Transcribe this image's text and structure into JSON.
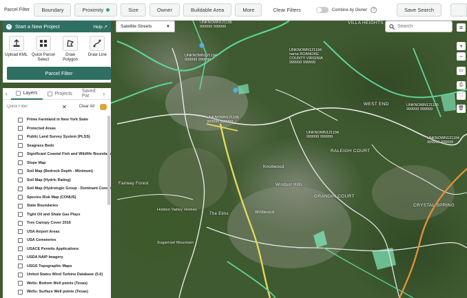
{
  "topbar": {
    "label": "Parcel Filter",
    "buttons": [
      "Boundary",
      "Proximity",
      "Size",
      "Owner",
      "Buildable Area",
      "More"
    ],
    "clear": "Clear Filters",
    "combine": "Combine by Owner",
    "info": "?",
    "save": "Save Search"
  },
  "map": {
    "style_label": "Satellite Streets",
    "search_placeholder": "Search",
    "controls": [
      "+",
      "−"
    ],
    "parcel_labels": [
      "UNKNOWN121195\n999999 999999",
      "UNKNOWN121194\n999999 999999",
      "UNKNOWN121194\nname ROANOKE\nCOUNTY VIRGINIA\n999999 999999",
      "UNKNOWN121195\n999999 999999",
      "UNKNOWN121194\n999999 999999",
      "UNKNOWN121194\n999999 999999",
      "UNKNOWN121195\n999999 999999"
    ],
    "places": [
      "VILLA\nHEIGHTS",
      "WEST END",
      "RALEIGH\nCOURT",
      "GRANDIN\nCOURT",
      "CRYSTAL\nSPRING",
      "Hidden Valley\nHomes",
      "Windsor Hills",
      "Fairway Forest",
      "Sugarloaf Mountain",
      "The Elms",
      "Knollwood",
      "Wildwood"
    ]
  },
  "panel": {
    "header": "Start a New Project",
    "help": "Help",
    "tools": [
      {
        "label": "Upload KML",
        "icon": "upload-icon"
      },
      {
        "label": "Quick Parcel Select",
        "icon": "grid-icon"
      },
      {
        "label": "Draw Polygon",
        "icon": "polygon-icon"
      },
      {
        "label": "Draw Line",
        "icon": "line-icon"
      }
    ],
    "filter_button": "Parcel Filter",
    "tabs": [
      "Layers",
      "Projects",
      "Saved Par"
    ],
    "quick_filter_placeholder": "Quick Filter",
    "clear_all": "Clear All",
    "layers": [
      "Prime Farmland in New York State",
      "Protected Areas",
      "Public Land Survey System (PLSS)",
      "Seagrass Beds",
      "Significant Coastal Fish and Wildlife Boundaries",
      "Slope Map",
      "Soil Map (Bedrock Depth - Minimum)",
      "Soil Map (Hydric Rating)",
      "Soil Map (Hydrologic Group - Dominant Conditio...",
      "Species Risk Map (CONUS)",
      "State Boundaries",
      "Tight Oil and Shale Gas Plays",
      "Tree Canopy Cover 2016",
      "USA Airport Areas",
      "USA Cemeteries",
      "USACE Permits Applications",
      "USDA NAIP Imagery",
      "USGS Topographic Maps",
      "United States Wind Turbine Database (5.0)",
      "Wells: Bottom Well points (Texas)",
      "Wells: Surface Well points (Texas)"
    ]
  }
}
